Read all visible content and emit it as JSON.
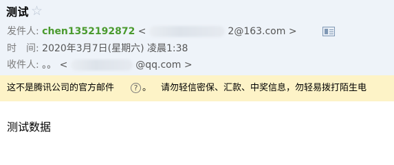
{
  "email": {
    "subject": "测试",
    "star_icon": "star-outline-icon",
    "sender": {
      "label": "发件人:",
      "name": "chen1352192872",
      "addr_open": "<",
      "addr_visible": "2@163.com",
      "addr_close": ">",
      "contact_icon": "contact-card-icon"
    },
    "time": {
      "label": "时　间:",
      "value": "2020年3月7日(星期六) 凌晨1:38"
    },
    "recipient": {
      "label": "收件人:",
      "name": "。。",
      "addr_open": "<",
      "addr_visible": "@qq.com",
      "addr_close": ">"
    },
    "warning": {
      "text1": "这不是腾讯公司的官方邮件",
      "help_icon": "help-question-icon",
      "help_glyph": "?",
      "period": "。",
      "text2": "请勿轻信密保、汇款、中奖信息，勿轻易拨打陌生电"
    },
    "body": "测试数据"
  },
  "colors": {
    "header_bg": "#eef3f9",
    "sender_name": "#4a9a2e",
    "warning_bg": "#fdf3c7"
  }
}
